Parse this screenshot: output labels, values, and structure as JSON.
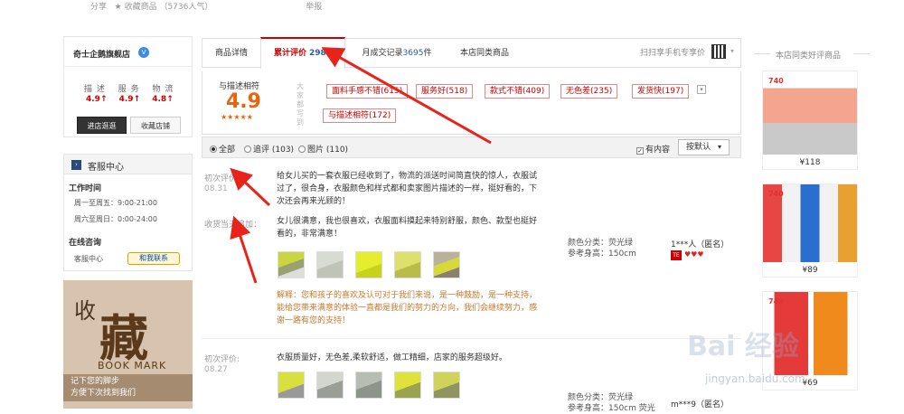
{
  "top": {
    "share": "分享",
    "fav": "收藏商品",
    "fav_count": "（5736人气）",
    "report": "举报"
  },
  "shop": {
    "name": "奇士企鹅旗舰店",
    "badge": "V",
    "labels": [
      "描 述",
      "服 务",
      "物 流"
    ],
    "scores": [
      "4.9↑",
      "4.9↑",
      "4.8↑"
    ],
    "enter_btn": "进店逛逛",
    "fav_btn": "收藏店铺"
  },
  "service": {
    "title": "客服中心",
    "work_time_label": "工作时间",
    "time1": "周一至周五：9:00-21:00",
    "time2": "周六至周日：0:00-24:00",
    "online_label": "在线咨询",
    "online_name": "客服中心",
    "contact_btn": "和我联系"
  },
  "bookmark": {
    "big1": "收",
    "big2": "藏",
    "en": "BOOK MARK",
    "line1": "记下您的脚步",
    "line2": "方便下次找到我们"
  },
  "tabs": {
    "detail": "商品详情",
    "reviews": "累计评价",
    "reviews_count": "2982",
    "sales": "月成交记录",
    "sales_count": "3695",
    "sales_unit": "件",
    "same": "本店同类商品",
    "mobile": "扫扫享手机专享价"
  },
  "rating": {
    "label": "与描述相符",
    "score": "4.9",
    "stars": "★★★★★",
    "side": "大家都写到",
    "tags": [
      "面料手感不错(615)",
      "服务好(518)",
      "款式不错(409)",
      "无色差(235)",
      "发货快(197)",
      "与描述相符(172)"
    ]
  },
  "filter": {
    "all": "全部",
    "append": "追评 (103)",
    "image": "图片 (110)",
    "has_content": "有内容",
    "sort": "按默认"
  },
  "reviews": [
    {
      "label": "初次评价:",
      "date": "08.31",
      "text": [
        "给女儿买的一套衣服已经收到了，物流的派送时间简直快的惊人，衣服试",
        "过了，很合身，衣服颜色和样式都和卖家图片描述的一样，挺好看的，下",
        "次还会再来光顾的！"
      ],
      "append_label": "收货当天追加：",
      "append_text": [
        "女儿很满意，我也很喜欢，衣服面料摸起来特别舒服，颜色、款型也挺好",
        "看的，非常满意！"
      ],
      "reply": [
        "解释：您和孩子的喜欢及认可对于我们来说，是一种鼓励，是一种支持，",
        "能给您带来满意的体验一直都是我们的努力的方向，我们会继续努力，感",
        "谢一路有您的支持！"
      ],
      "color": "颜色分类：荧光绿",
      "height": "参考身高：150cm",
      "user": "1***人（匿名）"
    },
    {
      "label": "初次评价:",
      "date": "08.27",
      "text": [
        "衣服质量好，无色差,柔软舒适，做工精细，店家的服务超级好。"
      ],
      "color": "颜色分类：荧光绿",
      "height": "参考身高：150cm 荧光",
      "user": "m***9（匿名）"
    }
  ],
  "right": {
    "title": "本店同类好评商品",
    "logo": "740",
    "prices": [
      "¥118",
      "¥89",
      "¥69"
    ]
  },
  "watermark": {
    "main": "Bai 经验",
    "url": "jingyan.baidu.com"
  }
}
